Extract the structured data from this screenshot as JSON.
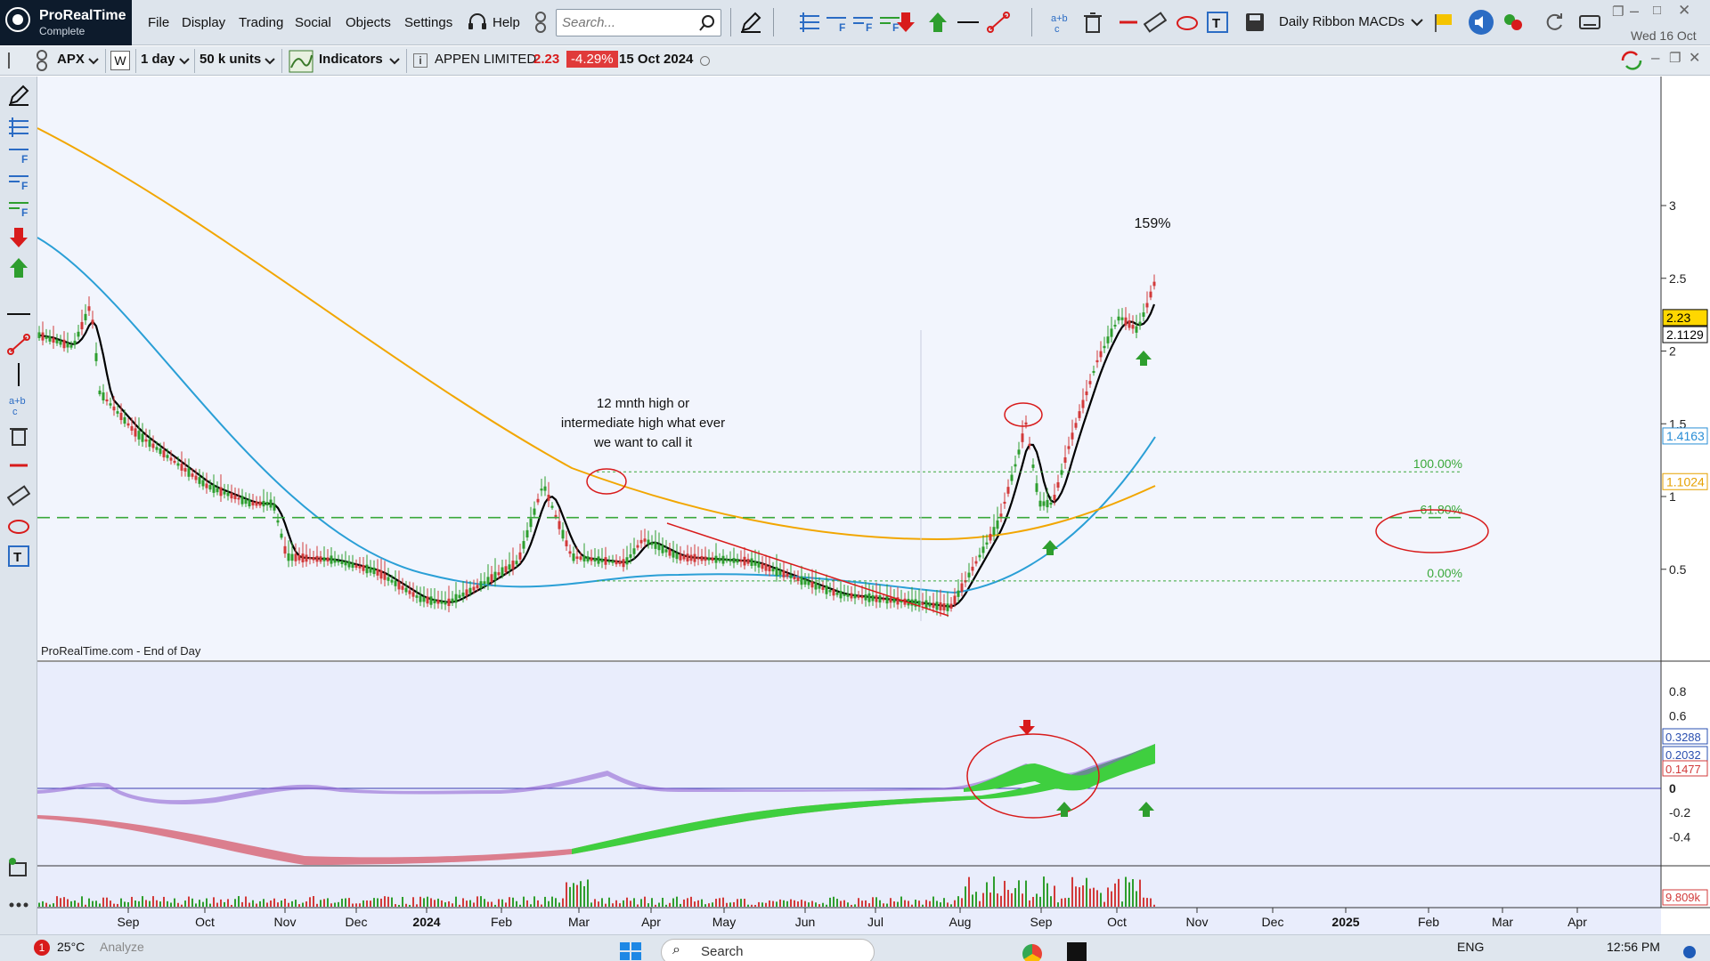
{
  "app": {
    "name": "ProRealTime",
    "edition": "Complete"
  },
  "menu": [
    "File",
    "Display",
    "Trading",
    "Social",
    "Objects",
    "Settings",
    "Help"
  ],
  "search": {
    "placeholder": "Search..."
  },
  "toolbar": {
    "ribbon_name": "Daily Ribbon MACDs",
    "date": "Wed 16 Oct"
  },
  "instrument": {
    "ticker": "APX",
    "interval": "1 day",
    "units": "50 k units",
    "indicators_label": "Indicators",
    "name": "APPEN LIMITED",
    "price": "2.23",
    "change": "-4.29%",
    "date": "15 Oct 2024"
  },
  "chart": {
    "source_label": "ProRealTime.com - End of Day",
    "annotation_text": [
      "12 mnth high or",
      "intermediate high what ever",
      "we want to call it"
    ],
    "gain_label": "159%",
    "fib_levels": [
      {
        "label": "100.00%",
        "value": 1.17
      },
      {
        "label": "61.80%",
        "value": 0.855
      },
      {
        "label": "0.00%",
        "value": 0.42
      }
    ],
    "price_axis_ticks": [
      "3",
      "2.5",
      "2",
      "1.5",
      "1",
      "0.5"
    ],
    "price_tags": [
      {
        "text": "2.23",
        "value": 2.23,
        "bg": "#ffd700",
        "color": "#000000"
      },
      {
        "text": "2.1129",
        "value": 2.1129,
        "bg": "#ffffff",
        "color": "#000000"
      },
      {
        "text": "1.4163",
        "value": 1.4163,
        "bg": "#ffffff",
        "color": "#2a8ed6"
      },
      {
        "text": "1.1024",
        "value": 1.1024,
        "bg": "#ffffff",
        "color": "#e6a100"
      }
    ],
    "macd_axis_ticks": [
      "0.8",
      "0.6",
      "0.4",
      "0.2",
      "0",
      "-0.2",
      "-0.4"
    ],
    "macd_tags": [
      {
        "text": "0.3288",
        "color": "#2a4fb0"
      },
      {
        "text": "0.2032",
        "color": "#2a4fb0"
      },
      {
        "text": "0.1477",
        "color": "#d23a3a"
      }
    ],
    "volume_tag": "9.809k",
    "x_labels": [
      {
        "text": "Sep",
        "bold": false
      },
      {
        "text": "Oct",
        "bold": false
      },
      {
        "text": "Nov",
        "bold": false
      },
      {
        "text": "Dec",
        "bold": false
      },
      {
        "text": "2024",
        "bold": true
      },
      {
        "text": "Feb",
        "bold": false
      },
      {
        "text": "Mar",
        "bold": false
      },
      {
        "text": "Apr",
        "bold": false
      },
      {
        "text": "May",
        "bold": false
      },
      {
        "text": "Jun",
        "bold": false
      },
      {
        "text": "Jul",
        "bold": false
      },
      {
        "text": "Aug",
        "bold": false
      },
      {
        "text": "Sep",
        "bold": false
      },
      {
        "text": "Oct",
        "bold": false
      },
      {
        "text": "Nov",
        "bold": false
      },
      {
        "text": "Dec",
        "bold": false
      },
      {
        "text": "2025",
        "bold": true
      },
      {
        "text": "Feb",
        "bold": false
      },
      {
        "text": "Mar",
        "bold": false
      },
      {
        "text": "Apr",
        "bold": false
      }
    ],
    "colors": {
      "up": "#2e9e2e",
      "down": "#d23a3a",
      "ma_fast": "#000000",
      "ma_mid": "#2a9fd6",
      "ma_slow": "#f2a600",
      "fib": "#3aa83a",
      "circle": "#d81b1b",
      "bg": "#f2f5fd"
    }
  },
  "taskbar": {
    "weather": "25°C",
    "search": "Search",
    "language": "ENG",
    "time": "12:56 PM",
    "tab_label": "Analyze"
  }
}
